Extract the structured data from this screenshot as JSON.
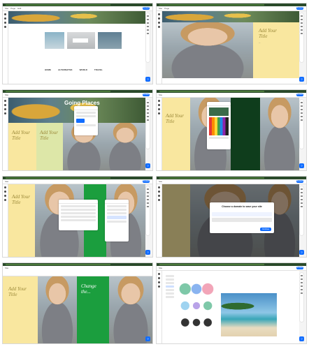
{
  "tiles": [
    {
      "id": "t1",
      "sections": [
        "HOME",
        "ALTERNATIVE",
        "WORLD",
        "TRAVEL"
      ]
    },
    {
      "id": "t2",
      "title": "Add Your Title"
    },
    {
      "id": "t3",
      "banner": "Going Places",
      "title": "Add Your Title"
    },
    {
      "id": "t4",
      "title": "Add Your Title"
    },
    {
      "id": "t5",
      "title": "Add Your Title"
    },
    {
      "id": "t6",
      "dialog_title": "Choose a domain to save your site",
      "button": "Continue"
    },
    {
      "id": "t7",
      "title": "Add Your Title",
      "green_title": "Change the..."
    },
    {
      "id": "t8"
    }
  ],
  "editor": {
    "publish": "Publish",
    "menu": [
      "Site",
      "Page",
      "Edit",
      "View",
      "Tools",
      "Search"
    ],
    "help": "?"
  },
  "colors": {
    "accent": "#116dff",
    "yellow": "#f9e79f",
    "green": "#1b9e3e"
  }
}
